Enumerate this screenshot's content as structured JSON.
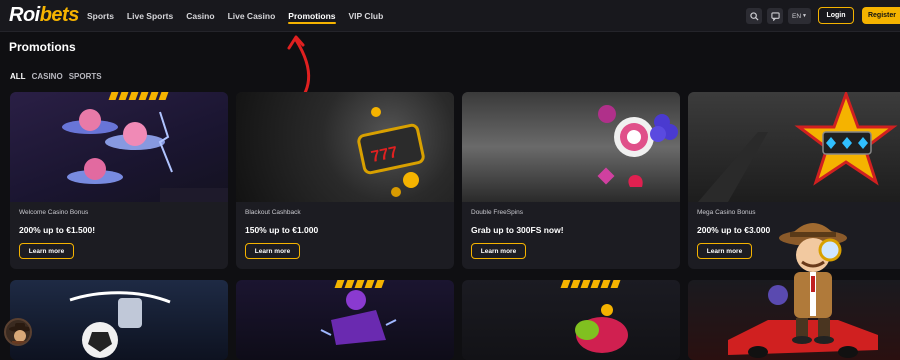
{
  "brand": {
    "roi": "Roi",
    "bets": "bets"
  },
  "nav": {
    "items": [
      {
        "label": "Sports"
      },
      {
        "label": "Live Sports"
      },
      {
        "label": "Casino"
      },
      {
        "label": "Live Casino"
      },
      {
        "label": "Promotions",
        "active": true
      },
      {
        "label": "VIP Club"
      }
    ]
  },
  "header": {
    "lang": "EN",
    "login": "Login",
    "register": "Register",
    "icons": [
      "search-icon",
      "chat-icon"
    ]
  },
  "page": {
    "title": "Promotions"
  },
  "filters": [
    "ALL",
    "CASINO",
    "SPORTS"
  ],
  "cards": [
    {
      "subtitle": "Welcome Casino Bonus",
      "title": "200% up to €1.500!",
      "button": "Learn more"
    },
    {
      "subtitle": "Blackout Cashback",
      "title": "150% up to €1.000",
      "button": "Learn more"
    },
    {
      "subtitle": "Double FreeSpins",
      "title": "Grab up to 300FS now!",
      "button": "Learn more"
    },
    {
      "subtitle": "Mega Casino Bonus",
      "title": "200% up to €3.000",
      "button": "Learn more"
    }
  ],
  "colors": {
    "accent": "#f5b300",
    "bg": "#0f0f12",
    "card": "#1c1c22"
  }
}
